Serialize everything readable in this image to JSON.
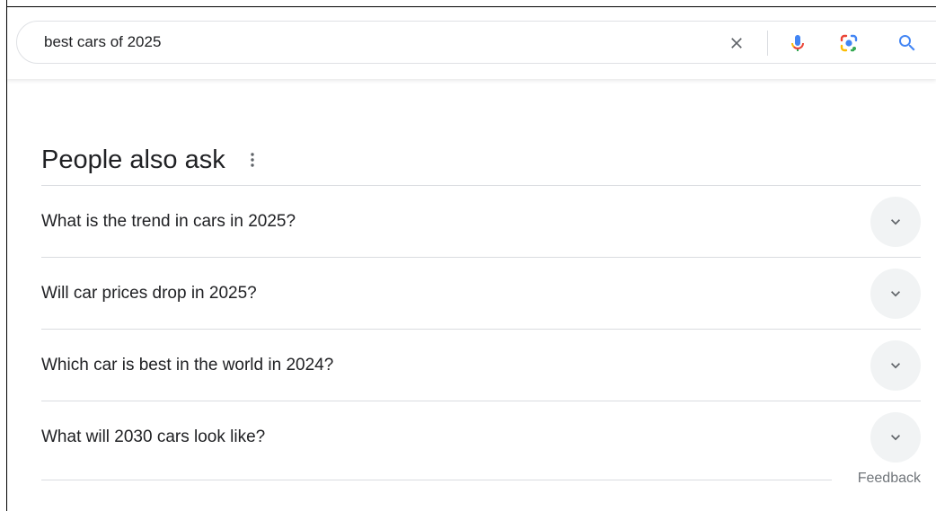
{
  "search": {
    "query": "best cars of 2025",
    "clear_icon": "close-icon",
    "voice_icon": "microphone-icon",
    "lens_icon": "google-lens-icon",
    "search_icon": "search-icon"
  },
  "people_also_ask": {
    "title": "People also ask",
    "more_icon": "more-vert-icon",
    "questions": [
      {
        "text": "What is the trend in cars in 2025?",
        "icon": "chevron-down-icon"
      },
      {
        "text": "Will car prices drop in 2025?",
        "icon": "chevron-down-icon"
      },
      {
        "text": "Which car is best in the world in 2024?",
        "icon": "chevron-down-icon"
      },
      {
        "text": "What will 2030 cars look like?",
        "icon": "chevron-down-icon"
      }
    ]
  },
  "feedback": {
    "label": "Feedback"
  },
  "colors": {
    "text": "#202124",
    "secondary_text": "#70757a",
    "search_blue": "#4285f4",
    "mic_red": "#ea4335",
    "mic_yellow": "#fbbc04",
    "mic_green": "#34a853",
    "chevron_bg": "#f1f3f4",
    "divider": "#dadce0"
  }
}
